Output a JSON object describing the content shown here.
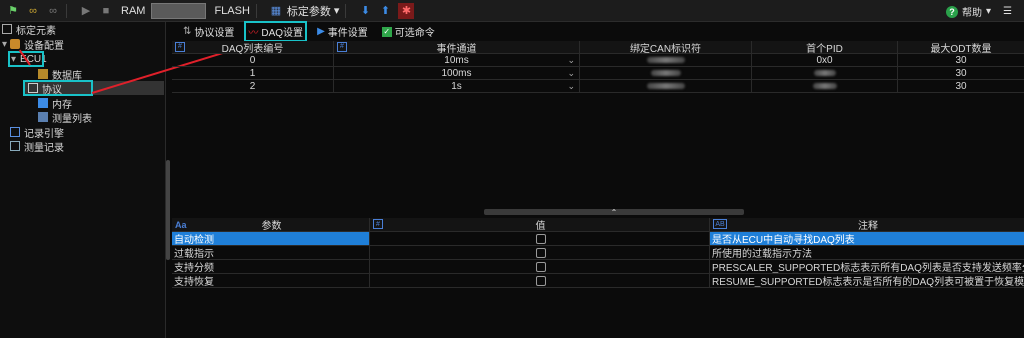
{
  "toolbar": {
    "ram_label": "RAM",
    "flash_label": "FLASH",
    "calib_params_label": "标定参数",
    "help_label": "帮助"
  },
  "tree": {
    "items": [
      {
        "label": "标定元素"
      },
      {
        "label": "设备配置"
      },
      {
        "label": "ECU1"
      },
      {
        "label": "数据库"
      },
      {
        "label": "协议"
      },
      {
        "label": "内存"
      },
      {
        "label": "测量列表"
      },
      {
        "label": "记录引擎"
      },
      {
        "label": "测量记录"
      }
    ]
  },
  "subtabs": {
    "protocol_settings": "协议设置",
    "daq_settings": "DAQ设置",
    "event_settings": "事件设置",
    "optional_commands": "可选命令"
  },
  "daq_table": {
    "columns": [
      "DAQ列表编号",
      "事件通道",
      "绑定CAN标识符",
      "首个PID",
      "最大ODT数量"
    ],
    "rows": [
      {
        "id": "0",
        "channel": "10ms",
        "pid": "0x0",
        "max_odt": "30"
      },
      {
        "id": "1",
        "channel": "100ms",
        "pid": "",
        "max_odt": "30"
      },
      {
        "id": "2",
        "channel": "1s",
        "pid": "",
        "max_odt": "30"
      }
    ]
  },
  "param_table": {
    "columns": [
      "参数",
      "值",
      "注释"
    ],
    "type_tags": [
      "Aa",
      "#",
      "AB"
    ],
    "rows": [
      {
        "param": "自动检测",
        "comment": "是否从ECU中自动寻找DAQ列表"
      },
      {
        "param": "过载指示",
        "comment": "所使用的过载指示方法"
      },
      {
        "param": "支持分频",
        "comment": "PRESCALER_SUPPORTED标志表示所有DAQ列表是否支持发送频率分频"
      },
      {
        "param": "支持恢复",
        "comment": "RESUME_SUPPORTED标志表示是否所有的DAQ列表可被置于恢复模式"
      }
    ]
  },
  "colors": {
    "highlight": "#19c2c8",
    "arrow": "#e0202a",
    "selection": "#1f7fd8"
  }
}
